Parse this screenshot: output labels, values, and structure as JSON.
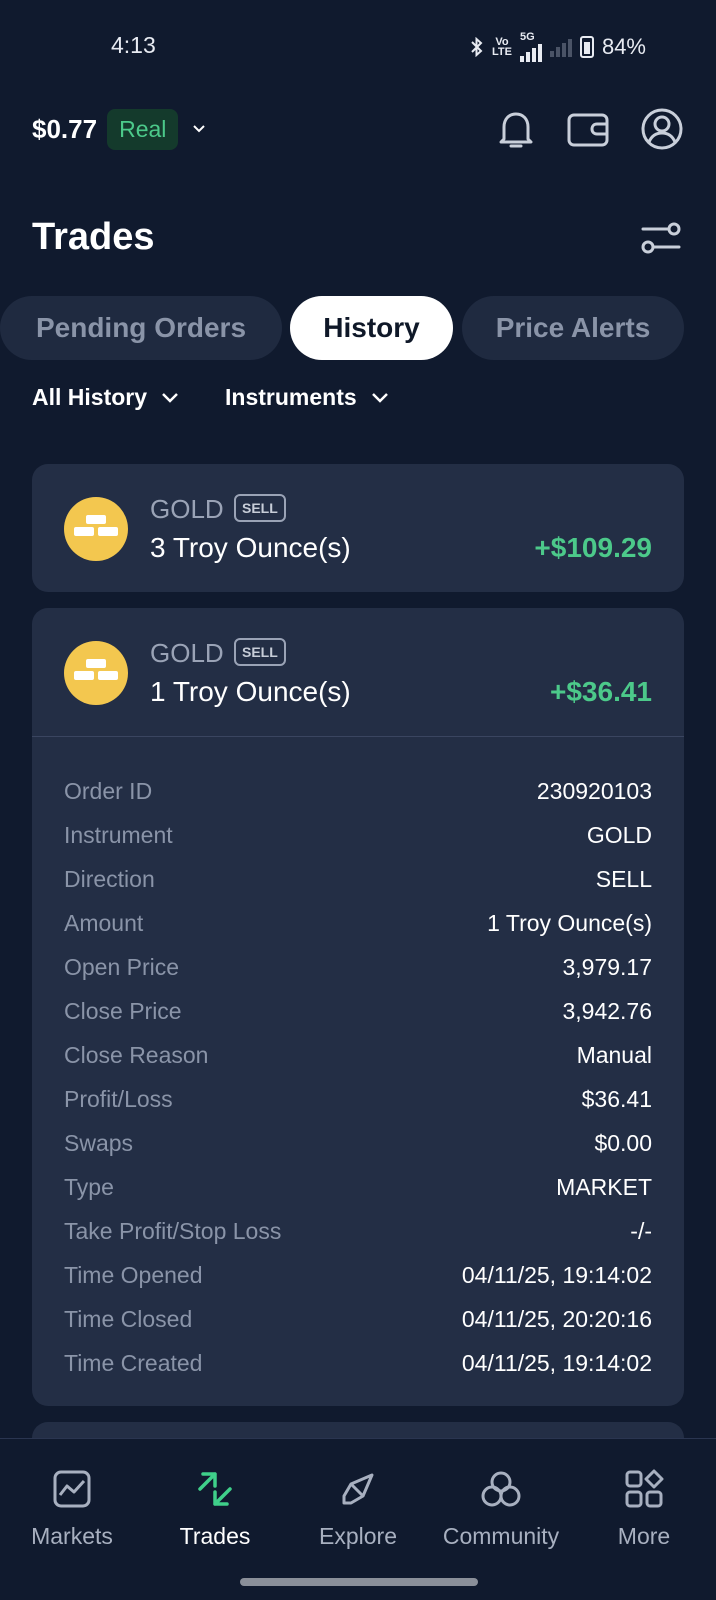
{
  "status_bar": {
    "time": "4:13",
    "volte_top": "Vo",
    "volte_bottom": "LTE",
    "network": "5G",
    "battery": "84%"
  },
  "header": {
    "balance": "$0.77",
    "account_type": "Real"
  },
  "page": {
    "title": "Trades"
  },
  "tabs": [
    {
      "label": "Pending Orders",
      "active": false
    },
    {
      "label": "History",
      "active": true
    },
    {
      "label": "Price Alerts",
      "active": false
    }
  ],
  "filters": {
    "history": "All History",
    "instruments": "Instruments"
  },
  "trades": [
    {
      "instrument": "GOLD",
      "side": "SELL",
      "quantity": "3 Troy Ounce(s)",
      "pnl": "+$109.29"
    },
    {
      "instrument": "GOLD",
      "side": "SELL",
      "quantity": "1 Troy Ounce(s)",
      "pnl": "+$36.41",
      "details": [
        {
          "label": "Order ID",
          "value": "230920103"
        },
        {
          "label": "Instrument",
          "value": "GOLD"
        },
        {
          "label": "Direction",
          "value": "SELL"
        },
        {
          "label": "Amount",
          "value": "1 Troy Ounce(s)"
        },
        {
          "label": "Open Price",
          "value": "3,979.17"
        },
        {
          "label": "Close Price",
          "value": "3,942.76"
        },
        {
          "label": "Close Reason",
          "value": "Manual"
        },
        {
          "label": "Profit/Loss",
          "value": "$36.41"
        },
        {
          "label": "Swaps",
          "value": "$0.00"
        },
        {
          "label": "Type",
          "value": "MARKET"
        },
        {
          "label": "Take Profit/Stop Loss",
          "value": "-/-"
        },
        {
          "label": "Time Opened",
          "value": "04/11/25, 19:14:02"
        },
        {
          "label": "Time Closed",
          "value": "04/11/25, 20:20:16"
        },
        {
          "label": "Time Created",
          "value": "04/11/25, 19:14:02"
        }
      ]
    }
  ],
  "bottom_nav": [
    {
      "label": "Markets",
      "icon": "chart-icon",
      "active": false
    },
    {
      "label": "Trades",
      "icon": "trade-arrows-icon",
      "active": true
    },
    {
      "label": "Explore",
      "icon": "compass-icon",
      "active": false
    },
    {
      "label": "Community",
      "icon": "community-icon",
      "active": false
    },
    {
      "label": "More",
      "icon": "grid-icon",
      "active": false
    }
  ],
  "colors": {
    "background": "#101a2e",
    "card": "#232e45",
    "profit_green": "#4cc98a",
    "gold_coin": "#f3c74f",
    "active_nav_icon": "#3fd08a"
  }
}
